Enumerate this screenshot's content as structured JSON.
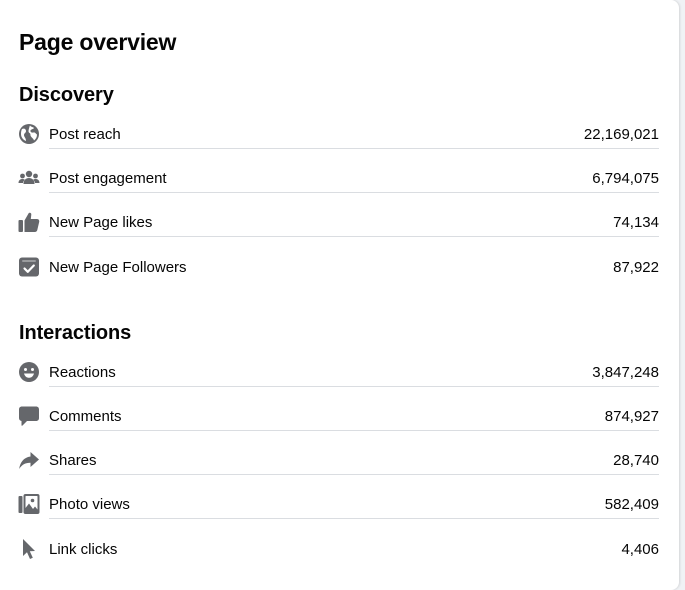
{
  "page": {
    "title": "Page overview"
  },
  "colors": {
    "icon": "#65676b",
    "text": "#050505",
    "divider": "#dadde1",
    "background": "#ffffff"
  },
  "discovery": {
    "title": "Discovery",
    "items": [
      {
        "icon": "globe-icon",
        "label": "Post reach",
        "value": "22,169,021"
      },
      {
        "icon": "people-icon",
        "label": "Post engagement",
        "value": "6,794,075"
      },
      {
        "icon": "thumbs-up-icon",
        "label": "New Page likes",
        "value": "74,134"
      },
      {
        "icon": "follow-check-icon",
        "label": "New Page Followers",
        "value": "87,922"
      }
    ]
  },
  "interactions": {
    "title": "Interactions",
    "items": [
      {
        "icon": "smiley-icon",
        "label": "Reactions",
        "value": "3,847,248"
      },
      {
        "icon": "comment-bubble-icon",
        "label": "Comments",
        "value": "874,927"
      },
      {
        "icon": "share-arrow-icon",
        "label": "Shares",
        "value": "28,740"
      },
      {
        "icon": "photo-icon",
        "label": "Photo views",
        "value": "582,409"
      },
      {
        "icon": "cursor-icon",
        "label": "Link clicks",
        "value": "4,406"
      }
    ]
  }
}
